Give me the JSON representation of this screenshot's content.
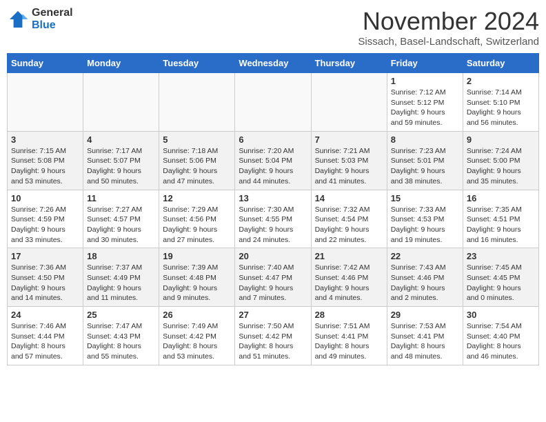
{
  "header": {
    "logo_general": "General",
    "logo_blue": "Blue",
    "month_title": "November 2024",
    "subtitle": "Sissach, Basel-Landschaft, Switzerland"
  },
  "days_of_week": [
    "Sunday",
    "Monday",
    "Tuesday",
    "Wednesday",
    "Thursday",
    "Friday",
    "Saturday"
  ],
  "weeks": [
    [
      {
        "day": "",
        "info": ""
      },
      {
        "day": "",
        "info": ""
      },
      {
        "day": "",
        "info": ""
      },
      {
        "day": "",
        "info": ""
      },
      {
        "day": "",
        "info": ""
      },
      {
        "day": "1",
        "info": "Sunrise: 7:12 AM\nSunset: 5:12 PM\nDaylight: 9 hours and 59 minutes."
      },
      {
        "day": "2",
        "info": "Sunrise: 7:14 AM\nSunset: 5:10 PM\nDaylight: 9 hours and 56 minutes."
      }
    ],
    [
      {
        "day": "3",
        "info": "Sunrise: 7:15 AM\nSunset: 5:08 PM\nDaylight: 9 hours and 53 minutes."
      },
      {
        "day": "4",
        "info": "Sunrise: 7:17 AM\nSunset: 5:07 PM\nDaylight: 9 hours and 50 minutes."
      },
      {
        "day": "5",
        "info": "Sunrise: 7:18 AM\nSunset: 5:06 PM\nDaylight: 9 hours and 47 minutes."
      },
      {
        "day": "6",
        "info": "Sunrise: 7:20 AM\nSunset: 5:04 PM\nDaylight: 9 hours and 44 minutes."
      },
      {
        "day": "7",
        "info": "Sunrise: 7:21 AM\nSunset: 5:03 PM\nDaylight: 9 hours and 41 minutes."
      },
      {
        "day": "8",
        "info": "Sunrise: 7:23 AM\nSunset: 5:01 PM\nDaylight: 9 hours and 38 minutes."
      },
      {
        "day": "9",
        "info": "Sunrise: 7:24 AM\nSunset: 5:00 PM\nDaylight: 9 hours and 35 minutes."
      }
    ],
    [
      {
        "day": "10",
        "info": "Sunrise: 7:26 AM\nSunset: 4:59 PM\nDaylight: 9 hours and 33 minutes."
      },
      {
        "day": "11",
        "info": "Sunrise: 7:27 AM\nSunset: 4:57 PM\nDaylight: 9 hours and 30 minutes."
      },
      {
        "day": "12",
        "info": "Sunrise: 7:29 AM\nSunset: 4:56 PM\nDaylight: 9 hours and 27 minutes."
      },
      {
        "day": "13",
        "info": "Sunrise: 7:30 AM\nSunset: 4:55 PM\nDaylight: 9 hours and 24 minutes."
      },
      {
        "day": "14",
        "info": "Sunrise: 7:32 AM\nSunset: 4:54 PM\nDaylight: 9 hours and 22 minutes."
      },
      {
        "day": "15",
        "info": "Sunrise: 7:33 AM\nSunset: 4:53 PM\nDaylight: 9 hours and 19 minutes."
      },
      {
        "day": "16",
        "info": "Sunrise: 7:35 AM\nSunset: 4:51 PM\nDaylight: 9 hours and 16 minutes."
      }
    ],
    [
      {
        "day": "17",
        "info": "Sunrise: 7:36 AM\nSunset: 4:50 PM\nDaylight: 9 hours and 14 minutes."
      },
      {
        "day": "18",
        "info": "Sunrise: 7:37 AM\nSunset: 4:49 PM\nDaylight: 9 hours and 11 minutes."
      },
      {
        "day": "19",
        "info": "Sunrise: 7:39 AM\nSunset: 4:48 PM\nDaylight: 9 hours and 9 minutes."
      },
      {
        "day": "20",
        "info": "Sunrise: 7:40 AM\nSunset: 4:47 PM\nDaylight: 9 hours and 7 minutes."
      },
      {
        "day": "21",
        "info": "Sunrise: 7:42 AM\nSunset: 4:46 PM\nDaylight: 9 hours and 4 minutes."
      },
      {
        "day": "22",
        "info": "Sunrise: 7:43 AM\nSunset: 4:46 PM\nDaylight: 9 hours and 2 minutes."
      },
      {
        "day": "23",
        "info": "Sunrise: 7:45 AM\nSunset: 4:45 PM\nDaylight: 9 hours and 0 minutes."
      }
    ],
    [
      {
        "day": "24",
        "info": "Sunrise: 7:46 AM\nSunset: 4:44 PM\nDaylight: 8 hours and 57 minutes."
      },
      {
        "day": "25",
        "info": "Sunrise: 7:47 AM\nSunset: 4:43 PM\nDaylight: 8 hours and 55 minutes."
      },
      {
        "day": "26",
        "info": "Sunrise: 7:49 AM\nSunset: 4:42 PM\nDaylight: 8 hours and 53 minutes."
      },
      {
        "day": "27",
        "info": "Sunrise: 7:50 AM\nSunset: 4:42 PM\nDaylight: 8 hours and 51 minutes."
      },
      {
        "day": "28",
        "info": "Sunrise: 7:51 AM\nSunset: 4:41 PM\nDaylight: 8 hours and 49 minutes."
      },
      {
        "day": "29",
        "info": "Sunrise: 7:53 AM\nSunset: 4:41 PM\nDaylight: 8 hours and 48 minutes."
      },
      {
        "day": "30",
        "info": "Sunrise: 7:54 AM\nSunset: 4:40 PM\nDaylight: 8 hours and 46 minutes."
      }
    ]
  ]
}
